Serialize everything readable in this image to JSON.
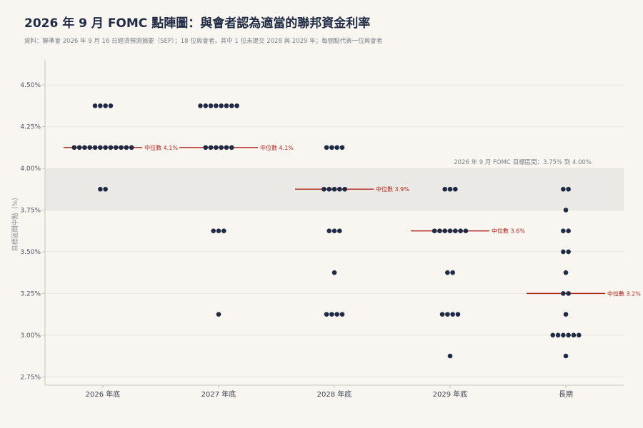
{
  "header": {
    "title": "2026 年 9 月 FOMC 點陣圖：與會者認為適當的聯邦資金利率",
    "subtitle": "資料：聯準會 2026 年 9 月 16 日經濟預測摘要（SEP）；18 位與會者，其中 1 位未提交 2028 與 2029 年；每個點代表一位與會者"
  },
  "chart_data": {
    "type": "scatter",
    "ylabel": "目標區間中點（%）",
    "ylim": [
      2.7,
      4.65
    ],
    "yticks": [
      {
        "value": 2.75,
        "label": "2.75%"
      },
      {
        "value": 3.0,
        "label": "3.00%"
      },
      {
        "value": 3.25,
        "label": "3.25%"
      },
      {
        "value": 3.5,
        "label": "3.50%"
      },
      {
        "value": 3.75,
        "label": "3.75%"
      },
      {
        "value": 4.0,
        "label": "4.00%"
      },
      {
        "value": 4.25,
        "label": "4.25%"
      },
      {
        "value": 4.5,
        "label": "4.50%"
      }
    ],
    "categories": [
      "2026 年底",
      "2027 年底",
      "2028 年底",
      "2029 年底",
      "長期"
    ],
    "band": {
      "low": 3.75,
      "high": 4.0,
      "label": "2026 年 9 月 FOMC 目標區間：3.75% 到 4.00%"
    },
    "dots": [
      [
        {
          "rate": 4.375,
          "count": 4
        },
        {
          "rate": 4.125,
          "count": 12
        },
        {
          "rate": 3.875,
          "count": 2
        }
      ],
      [
        {
          "rate": 4.375,
          "count": 8
        },
        {
          "rate": 4.125,
          "count": 6
        },
        {
          "rate": 3.625,
          "count": 3
        },
        {
          "rate": 3.125,
          "count": 1
        }
      ],
      [
        {
          "rate": 4.125,
          "count": 4
        },
        {
          "rate": 3.875,
          "count": 5
        },
        {
          "rate": 3.625,
          "count": 3
        },
        {
          "rate": 3.375,
          "count": 1
        },
        {
          "rate": 3.125,
          "count": 4
        }
      ],
      [
        {
          "rate": 3.875,
          "count": 3
        },
        {
          "rate": 3.625,
          "count": 7
        },
        {
          "rate": 3.375,
          "count": 2
        },
        {
          "rate": 3.125,
          "count": 4
        },
        {
          "rate": 2.875,
          "count": 1
        }
      ],
      [
        {
          "rate": 3.875,
          "count": 2
        },
        {
          "rate": 3.75,
          "count": 1
        },
        {
          "rate": 3.625,
          "count": 2
        },
        {
          "rate": 3.5,
          "count": 2
        },
        {
          "rate": 3.375,
          "count": 1
        },
        {
          "rate": 3.25,
          "count": 2
        },
        {
          "rate": 3.125,
          "count": 1
        },
        {
          "rate": 3.0,
          "count": 6
        },
        {
          "rate": 2.875,
          "count": 1
        }
      ]
    ],
    "medians": [
      {
        "value": 4.125,
        "label": "中位數 4.1%"
      },
      {
        "value": 4.125,
        "label": "中位數 4.1%"
      },
      {
        "value": 3.875,
        "label": "中位數 3.9%"
      },
      {
        "value": 3.625,
        "label": "中位數 3.6%"
      },
      {
        "value": 3.25,
        "label": "中位數 3.2%"
      }
    ],
    "colors": {
      "dot": "#1f2b44",
      "median": "#b0251c",
      "band": "#ebe9e5",
      "grid": "#ebe7e1",
      "axis": "#c9c6c0"
    }
  }
}
